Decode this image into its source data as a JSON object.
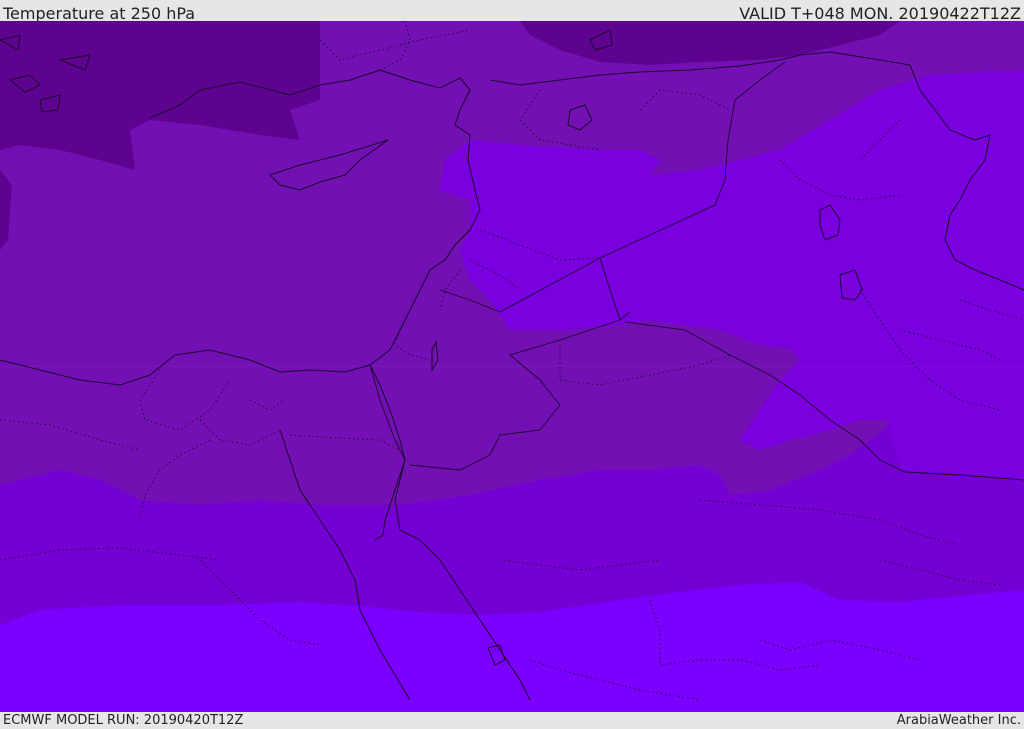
{
  "header": {
    "title": "Temperature at 250 hPa",
    "valid": "VALID T+048 MON. 20190422T12Z"
  },
  "footer": {
    "model_run": "ECMWF MODEL RUN: 20190420T12Z",
    "credit": "ArabiaWeather Inc."
  },
  "colors": {
    "band_coldest": "#5e0390",
    "band_cold": "#7210b4",
    "band_mid": "#7a00e0",
    "band_warm": "#7400d4",
    "band_warmest": "#7c00ff",
    "coast": "#1a0a2a"
  }
}
